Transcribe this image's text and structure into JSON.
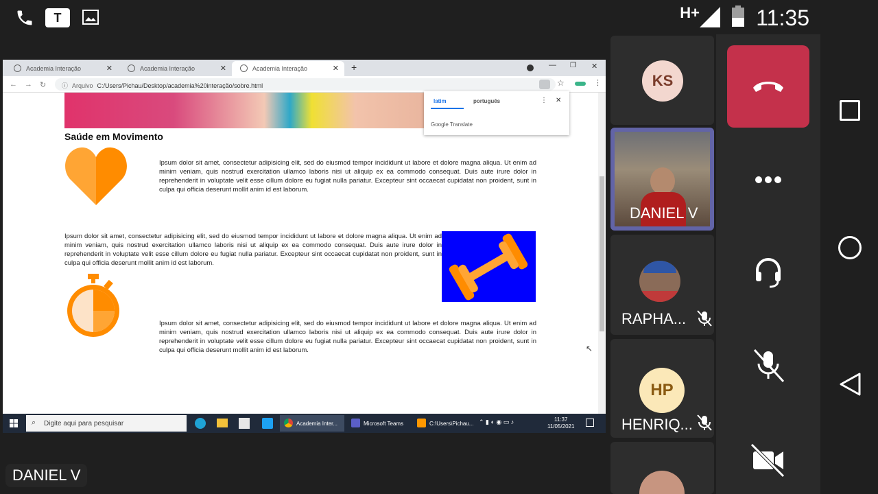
{
  "statusbar": {
    "network": "H+",
    "time": "11:35"
  },
  "browser": {
    "tabs": [
      {
        "label": "Academia Interação",
        "active": false
      },
      {
        "label": "Academia Interação",
        "active": false
      },
      {
        "label": "Academia Interação",
        "active": true
      }
    ],
    "address_prefix": "Arquivo",
    "address": "C:/Users/Pichau/Desktop/academia%20interação/sobre.html",
    "page": {
      "title": "Saúde em Movimento",
      "para1": "Ipsum dolor sit amet, consectetur adipisicing elit, sed do eiusmod tempor incididunt ut labore et dolore magna aliqua. Ut enim ad minim veniam, quis nostrud exercitation ullamco laboris nisi ut aliquip ex ea commodo consequat. Duis aute irure dolor in reprehenderit in voluptate velit esse cillum dolore eu fugiat nulla pariatur. Excepteur sint occaecat cupidatat non proident, sunt in culpa qui officia deserunt mollit anim id est laborum.",
      "para2": "Ipsum dolor sit amet, consectetur adipisicing elit, sed do eiusmod tempor incididunt ut labore et dolore magna aliqua. Ut enim ad minim veniam, quis nostrud exercitation ullamco laboris nisi ut aliquip ex ea commodo consequat. Duis aute irure dolor in reprehenderit in voluptate velit esse cillum dolore eu fugiat nulla pariatur. Excepteur sint occaecat cupidatat non proident, sunt in culpa qui officia deserunt mollit anim id est laborum.",
      "para3": "Ipsum dolor sit amet, consectetur adipisicing elit, sed do eiusmod tempor incididunt ut labore et dolore magna aliqua. Ut enim ad minim veniam, quis nostrud exercitation ullamco laboris nisi ut aliquip ex ea commodo consequat. Duis aute irure dolor in reprehenderit in voluptate velit esse cillum dolore eu fugiat nulla pariatur. Excepteur sint occaecat cupidatat non proident, sunt in culpa qui officia deserunt mollit anim id est laborum."
    },
    "translate": {
      "lang_from": "latim",
      "lang_to": "português",
      "brand": "Google Translate"
    }
  },
  "taskbar": {
    "search_placeholder": "Digite aqui para pesquisar",
    "apps": [
      "Academia Inter...",
      "Microsoft Teams",
      "C:\\Users\\Pichau..."
    ],
    "time": "11:37",
    "date": "11/05/2021"
  },
  "presenter": "DANIEL V",
  "participants": [
    {
      "initials": "KS",
      "name": ""
    },
    {
      "initials": "",
      "name": "DANIEL V"
    },
    {
      "initials": "",
      "name": "RAPHA..."
    },
    {
      "initials": "HP",
      "name": "HENRIQ..."
    }
  ],
  "colors": {
    "hangup": "#c4314b",
    "accent": "#1a73e8",
    "icon_orange": "#ff8c00",
    "dumbbell_bg": "#0000ff"
  }
}
